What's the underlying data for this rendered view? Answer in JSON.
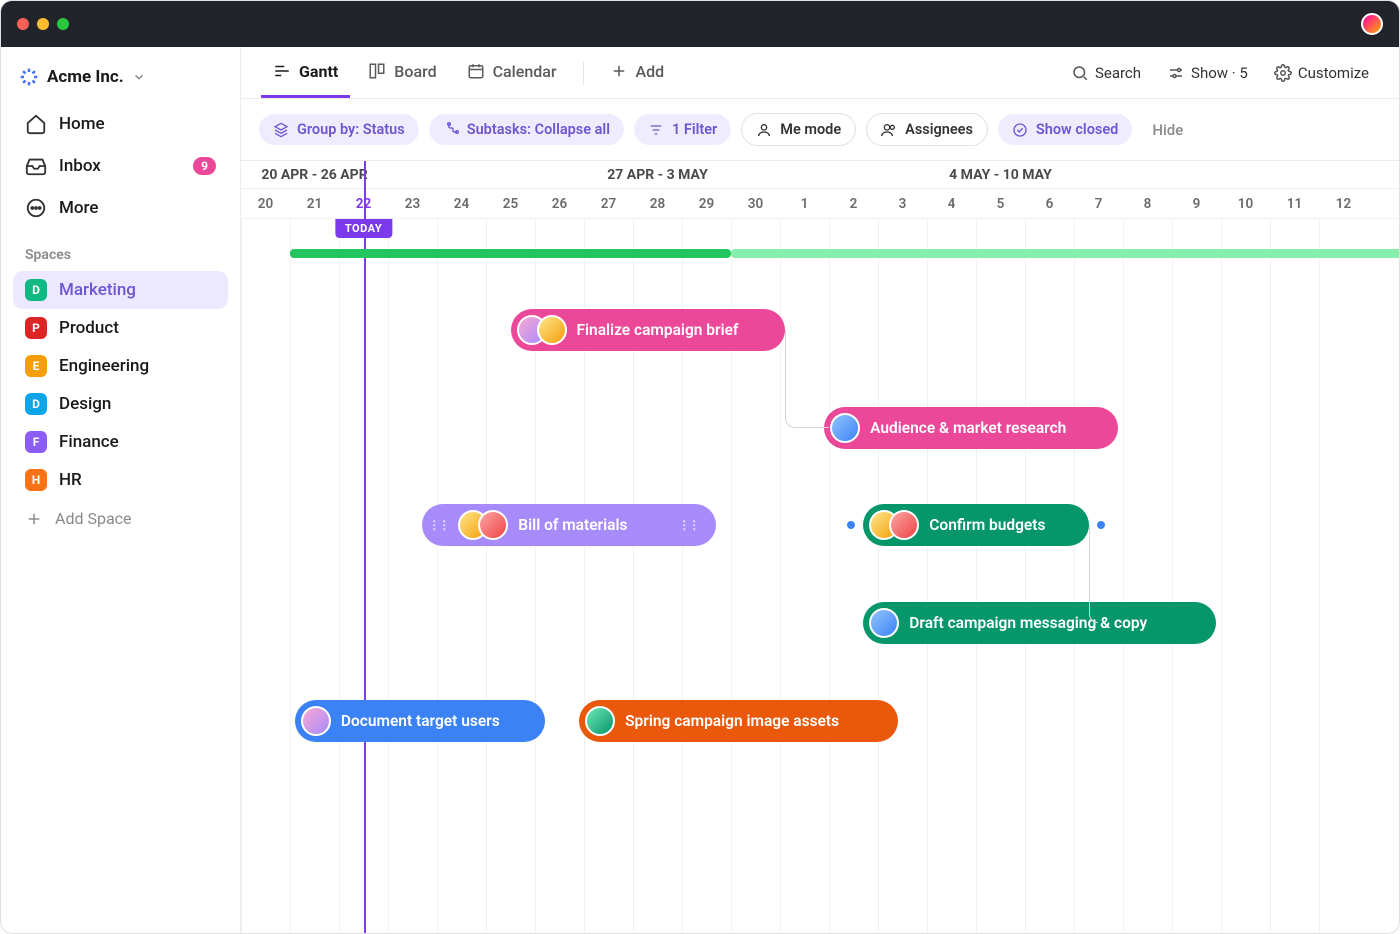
{
  "workspace": {
    "name": "Acme Inc."
  },
  "nav": {
    "home": "Home",
    "inbox": "Inbox",
    "inbox_badge": "9",
    "more": "More"
  },
  "spaces": {
    "label": "Spaces",
    "add_label": "Add Space",
    "items": [
      {
        "letter": "D",
        "name": "Marketing",
        "color": "#10b981",
        "active": true
      },
      {
        "letter": "P",
        "name": "Product",
        "color": "#dc2626",
        "active": false
      },
      {
        "letter": "E",
        "name": "Engineering",
        "color": "#f59e0b",
        "active": false
      },
      {
        "letter": "D",
        "name": "Design",
        "color": "#0ea5e9",
        "active": false
      },
      {
        "letter": "F",
        "name": "Finance",
        "color": "#8b5cf6",
        "active": false
      },
      {
        "letter": "H",
        "name": "HR",
        "color": "#f97316",
        "active": false
      }
    ]
  },
  "views": {
    "gantt": "Gantt",
    "board": "Board",
    "calendar": "Calendar",
    "add": "Add"
  },
  "toolbar": {
    "search": "Search",
    "show_label": "Show · 5",
    "customize": "Customize"
  },
  "filters": {
    "group_by": "Group by: Status",
    "subtasks": "Subtasks: Collapse all",
    "filter_count": "1 Filter",
    "me_mode": "Me mode",
    "assignees": "Assignees",
    "show_closed": "Show closed",
    "hide": "Hide"
  },
  "timeline": {
    "day_width": 49,
    "today_index": 2,
    "today_label": "TODAY",
    "weeks": [
      {
        "label": "20 APR - 26 APR",
        "span": 7,
        "offset": -2
      },
      {
        "label": "27 APR - 3 MAY",
        "span": 7,
        "offset": 5
      },
      {
        "label": "4 MAY - 10 MAY",
        "span": 7,
        "offset": 12
      }
    ],
    "days": [
      "20",
      "21",
      "22",
      "23",
      "24",
      "25",
      "26",
      "27",
      "28",
      "29",
      "30",
      "1",
      "2",
      "3",
      "4",
      "5",
      "6",
      "7",
      "8",
      "9",
      "10",
      "11",
      "12"
    ]
  },
  "tasks": [
    {
      "name": "Finalize campaign brief",
      "color": "pink",
      "start": 5.5,
      "span": 5.6,
      "row": 0,
      "avatars": [
        "a1",
        "a2"
      ]
    },
    {
      "name": "Audience & market research",
      "color": "pink",
      "start": 11.9,
      "span": 6,
      "row": 1,
      "avatars": [
        "a3"
      ]
    },
    {
      "name": "Bill of materials",
      "color": "purple",
      "start": 3.7,
      "span": 6,
      "row": 2,
      "avatars": [
        "a2",
        "a4"
      ],
      "handles": true
    },
    {
      "name": "Confirm budgets",
      "color": "green",
      "start": 12.7,
      "span": 4.6,
      "row": 2,
      "avatars": [
        "a2",
        "a4"
      ],
      "dots": true
    },
    {
      "name": "Draft campaign messaging & copy",
      "color": "green",
      "start": 12.7,
      "span": 7.2,
      "row": 3,
      "avatars": [
        "a3"
      ]
    },
    {
      "name": "Document target users",
      "color": "blue",
      "start": 1.1,
      "span": 5.1,
      "row": 4,
      "avatars": [
        "a1"
      ]
    },
    {
      "name": "Spring campaign image assets",
      "color": "orange",
      "start": 6.9,
      "span": 6.5,
      "row": 4,
      "avatars": [
        "a5"
      ]
    }
  ]
}
